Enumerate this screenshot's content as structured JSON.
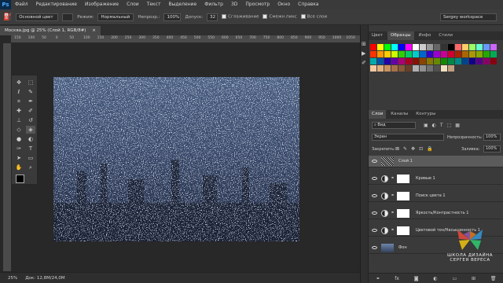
{
  "app": {
    "logo": "Ps"
  },
  "menu": [
    "Файл",
    "Редактирование",
    "Изображение",
    "Слои",
    "Текст",
    "Выделение",
    "Фильтр",
    "3D",
    "Просмотр",
    "Окно",
    "Справка"
  ],
  "options": {
    "source_value": "Основной цвет",
    "mode_label": "Режим:",
    "mode_value": "Нормальный",
    "opacity_label": "Непрозр.:",
    "opacity_value": "100%",
    "tolerance_label": "Допуск:",
    "tolerance_value": "32",
    "antialias_label": "Сглаживание",
    "contiguous_label": "Смежн.пикс",
    "all_layers_label": "Все слои",
    "workspace_value": "Sergey workspace"
  },
  "document": {
    "tab_title": "Москва.jpg @ 25% (Слой 1, RGB/8#)"
  },
  "ruler": {
    "h_ticks": [
      "150",
      "100",
      "50",
      "0",
      "50",
      "100",
      "150",
      "200",
      "250",
      "300",
      "350",
      "400",
      "450",
      "500",
      "550",
      "600",
      "650",
      "700",
      "750",
      "800",
      "850",
      "900",
      "950",
      "1000",
      "1050"
    ]
  },
  "status": {
    "zoom": "25%",
    "doc_info": "Док: 12,8M/24,0M"
  },
  "color_panel": {
    "tabs": [
      "Цвет",
      "Образцы",
      "Инфо",
      "Стили"
    ],
    "active_tab": 1,
    "swatch_colors": [
      "#ff0000",
      "#ffff00",
      "#00ff00",
      "#00ffff",
      "#0000ff",
      "#ff00ff",
      "#ffffff",
      "#cccccc",
      "#999999",
      "#666666",
      "#333333",
      "#000000",
      "#ff6666",
      "#ffcc66",
      "#99ff66",
      "#66ffcc",
      "#6699ff",
      "#cc66ff",
      "#ff3300",
      "#ff9900",
      "#ffcc00",
      "#ccff00",
      "#33cc00",
      "#00cc66",
      "#00cccc",
      "#0066cc",
      "#3300cc",
      "#9900cc",
      "#cc0099",
      "#cc0033",
      "#aa2200",
      "#aa6600",
      "#aa9900",
      "#88aa00",
      "#22aa00",
      "#00aa55",
      "#00aaaa",
      "#0055aa",
      "#2200aa",
      "#6600aa",
      "#aa0077",
      "#aa0022",
      "#881100",
      "#884400",
      "#887700",
      "#668800",
      "#118800",
      "#008844",
      "#008888",
      "#004488",
      "#110088",
      "#550088",
      "#880066",
      "#880011",
      "#f2c9a0",
      "#e0b080",
      "#c89060",
      "#a87048",
      "#885838",
      "#684028",
      "#b0b0b0",
      "#909090",
      "#707070",
      "#505050",
      "#f0e0c0",
      "#c0a080"
    ]
  },
  "layers_panel": {
    "tabs": [
      "Слои",
      "Каналы",
      "Контуры"
    ],
    "active_tab": 0,
    "filter_kind": "Вид",
    "blend_mode": "Экран",
    "opacity_label": "Непрозрачность:",
    "opacity_value": "100%",
    "lock_label": "Закрепить:",
    "fill_label": "Заливка:",
    "fill_value": "100%",
    "layers": [
      {
        "name": "Слой 1",
        "type": "noise"
      },
      {
        "name": "Кривые 1",
        "type": "adjustment"
      },
      {
        "name": "Поиск цвета 1",
        "type": "adjustment"
      },
      {
        "name": "Яркость/Контрастность 1",
        "type": "adjustment"
      },
      {
        "name": "Цветовой тон/Насыщенность 1",
        "type": "adjustment"
      },
      {
        "name": "Фон",
        "type": "photo"
      }
    ]
  },
  "branding": {
    "line1": "ШКОЛА ДИЗАЙНА",
    "line2": "СЕРГЕЯ ВЕРЕСА"
  }
}
